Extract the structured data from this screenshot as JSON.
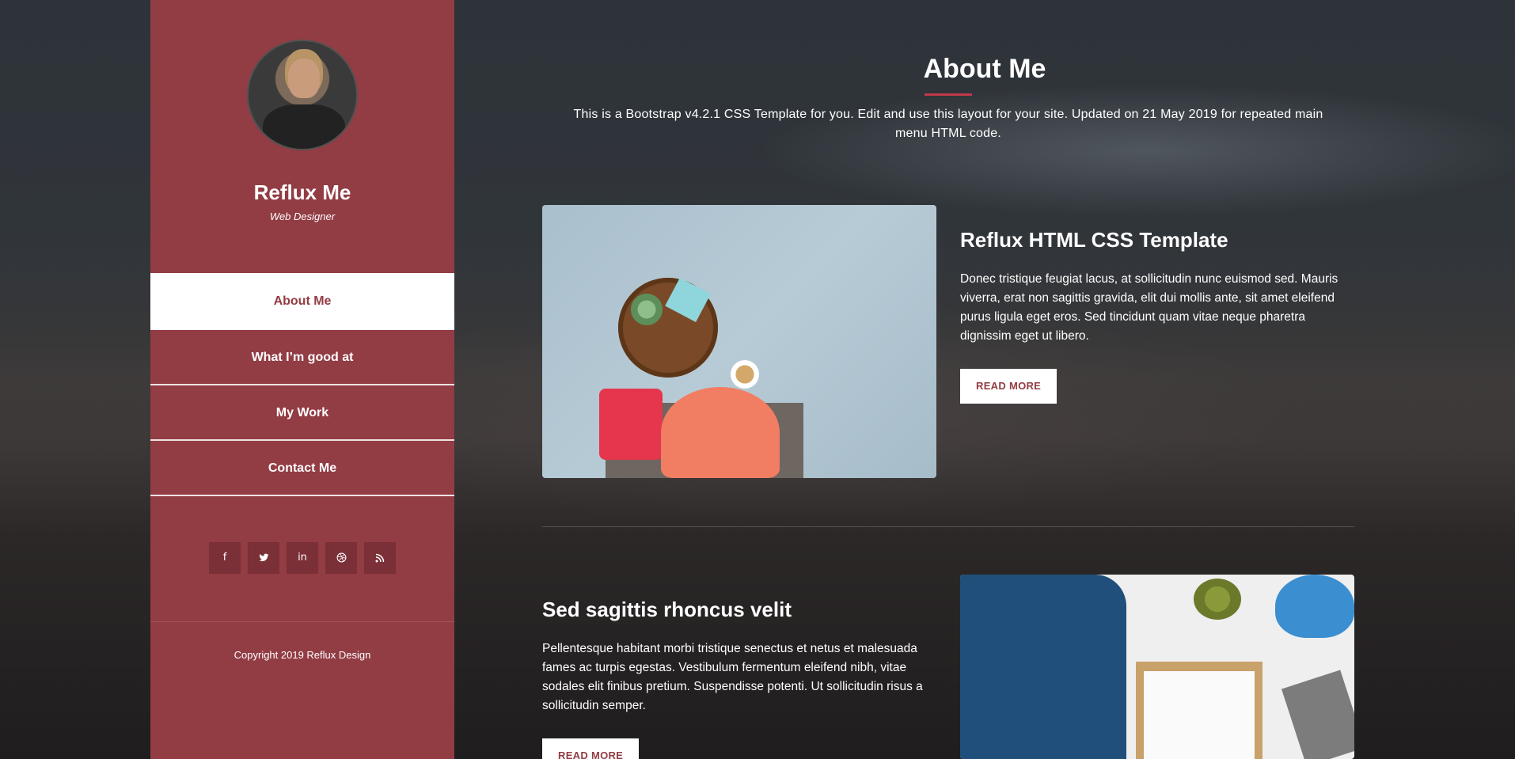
{
  "sidebar": {
    "name": "Reflux Me",
    "role": "Web Designer",
    "nav": [
      {
        "label": "About Me",
        "active": true
      },
      {
        "label": "What I’m good at",
        "active": false
      },
      {
        "label": "My Work",
        "active": false
      },
      {
        "label": "Contact Me",
        "active": false
      }
    ],
    "social": [
      {
        "icon": "facebook-icon",
        "glyph": "f"
      },
      {
        "icon": "twitter-icon",
        "glyph": "🐦"
      },
      {
        "icon": "linkedin-icon",
        "glyph": "in"
      },
      {
        "icon": "dribbble-icon",
        "glyph": "⊛"
      },
      {
        "icon": "rss-icon",
        "glyph": "◝"
      }
    ],
    "copyright": "Copyright 2019 Reflux Design"
  },
  "main": {
    "title": "About Me",
    "intro": "This is a Bootstrap v4.2.1 CSS Template for you. Edit and use this layout for your site. Updated on 21 May 2019 for repeated main menu HTML code.",
    "cards": [
      {
        "title": "Reflux HTML CSS Template",
        "text": "Donec tristique feugiat lacus, at sollicitudin nunc euismod sed. Mauris viverra, erat non sagittis gravida, elit dui mollis ante, sit amet eleifend purus ligula eget eros. Sed tincidunt quam vitae neque pharetra dignissim eget ut libero.",
        "button": "READ MORE"
      },
      {
        "title": "Sed sagittis rhoncus velit",
        "text": "Pellentesque habitant morbi tristique senectus et netus et malesuada fames ac turpis egestas. Vestibulum fermentum eleifend nibh, vitae sodales elit finibus pretium. Suspendisse potenti. Ut sollicitudin risus a sollicitudin semper.",
        "button": "READ MORE"
      }
    ]
  },
  "colors": {
    "accent": "#923c44",
    "title_rule": "#c0394a"
  }
}
